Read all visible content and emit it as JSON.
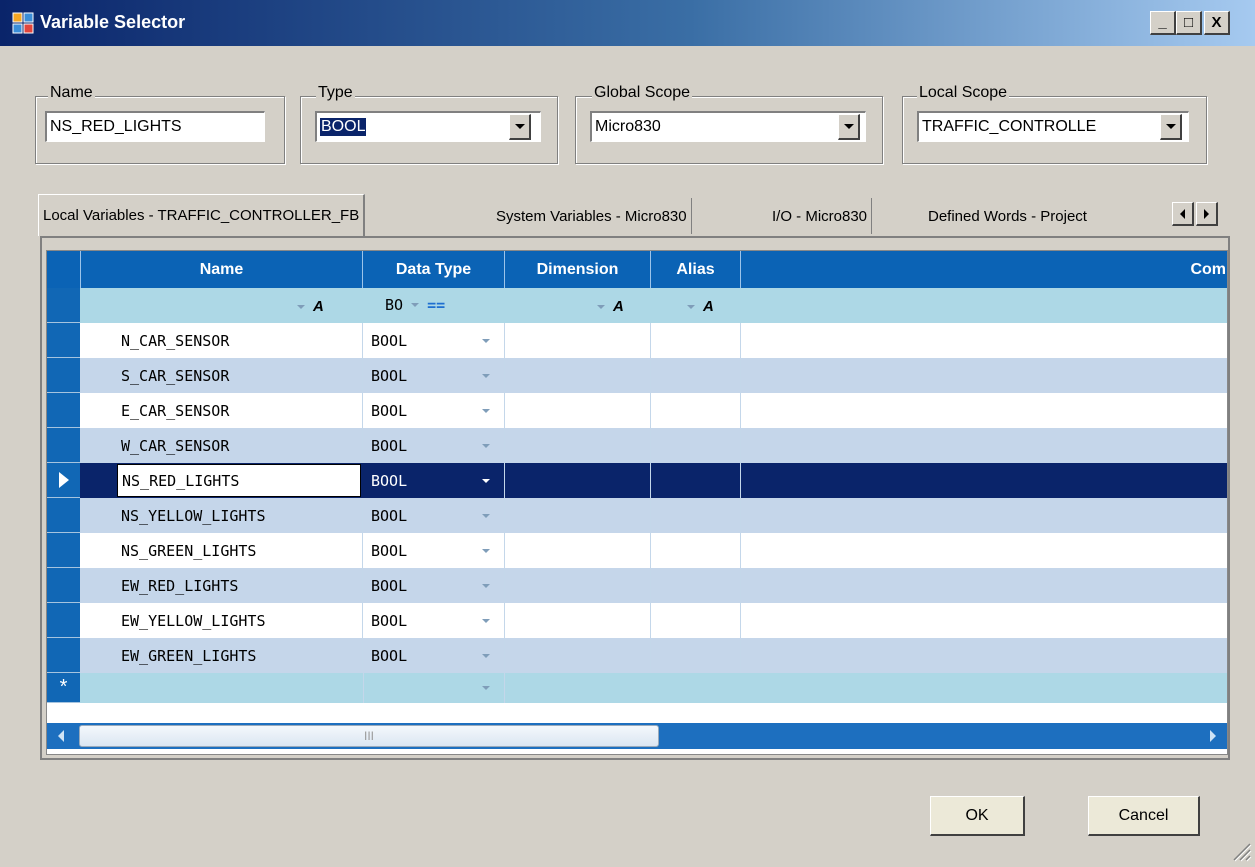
{
  "window": {
    "title": "Variable Selector",
    "min": "_",
    "max": "□",
    "close": "X"
  },
  "fields": {
    "name": {
      "label": "Name",
      "value": "NS_RED_LIGHTS"
    },
    "type": {
      "label": "Type",
      "value": "BOOL"
    },
    "global_scope": {
      "label": "Global Scope",
      "value": "Micro830"
    },
    "local_scope": {
      "label": "Local Scope",
      "value": "TRAFFIC_CONTROLLE"
    }
  },
  "tabs": [
    {
      "label": "Local Variables - TRAFFIC_CONTROLLER_FB",
      "active": true
    },
    {
      "label": "System Variables - Micro830",
      "active": false
    },
    {
      "label": "I/O - Micro830",
      "active": false
    },
    {
      "label": "Defined Words - Project",
      "active": false
    }
  ],
  "grid": {
    "columns": [
      "Name",
      "Data Type",
      "Dimension",
      "Alias",
      "Com"
    ],
    "filter_datatype": "BO",
    "filter_equals": "==",
    "rows": [
      {
        "name": "N_CAR_SENSOR",
        "type": "BOOL"
      },
      {
        "name": "S_CAR_SENSOR",
        "type": "BOOL"
      },
      {
        "name": "E_CAR_SENSOR",
        "type": "BOOL"
      },
      {
        "name": "W_CAR_SENSOR",
        "type": "BOOL"
      },
      {
        "name": "NS_RED_LIGHTS",
        "type": "BOOL"
      },
      {
        "name": "NS_YELLOW_LIGHTS",
        "type": "BOOL"
      },
      {
        "name": "NS_GREEN_LIGHTS",
        "type": "BOOL"
      },
      {
        "name": "EW_RED_LIGHTS",
        "type": "BOOL"
      },
      {
        "name": "EW_YELLOW_LIGHTS",
        "type": "BOOL"
      },
      {
        "name": "EW_GREEN_LIGHTS",
        "type": "BOOL"
      }
    ],
    "selected_row": 4,
    "new_row_marker": "*",
    "scroll_grip": "III"
  },
  "buttons": {
    "ok": "OK",
    "cancel": "Cancel"
  },
  "colors": {
    "header": "#0b63b5",
    "selected": "#0a246a",
    "alt_row": "#c5d6ea",
    "filter_row": "#add8e6"
  }
}
